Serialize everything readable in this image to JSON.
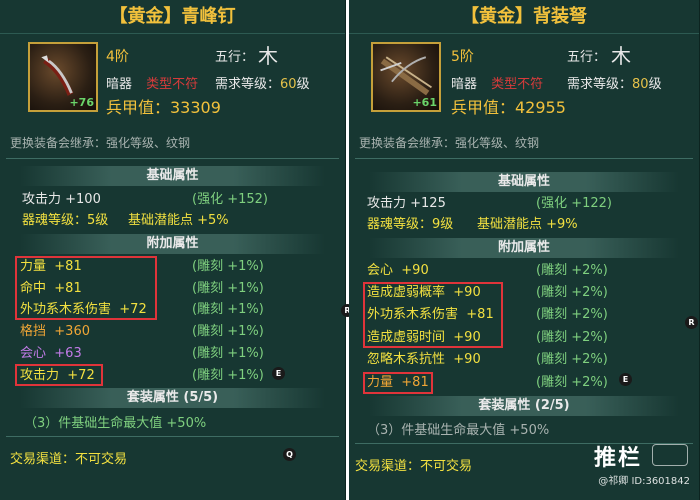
{
  "left": {
    "title": "【黄金】青峰钉",
    "icon_name": "dart-weapon-icon",
    "icon_level": "+76",
    "tier": "4阶",
    "wuxing_label": "五行：",
    "wuxing_glyph": "木",
    "type_label": "暗器",
    "type_status": "类型不符",
    "req_label": "需求等级：",
    "req_value": "60",
    "req_unit": "级",
    "bingjia": "兵甲值：33309",
    "note": "更换装备会继承：强化等级、纹钢",
    "basic_header": "基础属性",
    "basic": [
      {
        "left": "攻击力 +100",
        "right": "(强化 +152)"
      },
      {
        "left": "器魂等级：5级",
        "right": "基础潜能点 +5%"
      }
    ],
    "extra_header": "附加属性",
    "extra": [
      {
        "name": "力量",
        "val": "+81",
        "right": "(雕刻 +1%)",
        "color": "yellow"
      },
      {
        "name": "命中",
        "val": "+81",
        "right": "(雕刻 +1%)",
        "color": "yellow"
      },
      {
        "name": "外功系木系伤害",
        "val": "+72",
        "right": "(雕刻 +1%)",
        "color": "yellow"
      },
      {
        "name": "格挡",
        "val": "+360",
        "right": "(雕刻 +1%)",
        "color": "orange"
      },
      {
        "name": "会心",
        "val": "+63",
        "right": "(雕刻 +1%)",
        "color": "purple"
      },
      {
        "name": "攻击力",
        "val": "+72",
        "right": "(雕刻 +1%)",
        "color": "yellow"
      }
    ],
    "set_header": "套装属性 (5/5)",
    "set_bonus": "（3）件基础生命最大值  +50%",
    "trade": "交易渠道：不可交易",
    "btn_e": "E",
    "btn_r": "R",
    "btn_q": "Q"
  },
  "right": {
    "title": "【黄金】背装弩",
    "icon_name": "crossbow-weapon-icon",
    "icon_level": "+61",
    "tier": "5阶",
    "wuxing_label": "五行：",
    "wuxing_glyph": "木",
    "type_label": "暗器",
    "type_status": "类型不符",
    "req_label": "需求等级：",
    "req_value": "80",
    "req_unit": "级",
    "bingjia": "兵甲值：42955",
    "note": "更换装备会继承：强化等级、纹钢",
    "basic_header": "基础属性",
    "basic": [
      {
        "left": "攻击力 +125",
        "right": "(强化 +122)"
      },
      {
        "left": "器魂等级：9级",
        "right": "基础潜能点 +9%"
      }
    ],
    "extra_header": "附加属性",
    "extra": [
      {
        "name": "会心",
        "val": "+90",
        "right": "(雕刻 +2%)",
        "color": "yellow"
      },
      {
        "name": "造成虚弱概率",
        "val": "+90",
        "right": "(雕刻 +2%)",
        "color": "yellow"
      },
      {
        "name": "外功系木系伤害",
        "val": "+81",
        "right": "(雕刻 +2%)",
        "color": "yellow"
      },
      {
        "name": "造成虚弱时间",
        "val": "+90",
        "right": "(雕刻 +2%)",
        "color": "yellow"
      },
      {
        "name": "忽略木系抗性",
        "val": "+90",
        "right": "(雕刻 +2%)",
        "color": "yellow"
      },
      {
        "name": "力量",
        "val": "+81",
        "right": "(雕刻 +2%)",
        "color": "orange"
      }
    ],
    "set_header": "套装属性 (2/5)",
    "set_bonus": "（3）件基础生命最大值  +50%",
    "trade": "交易渠道：不可交易",
    "btn_e": "E",
    "btn_r": "R"
  },
  "watermark": {
    "big": "推栏",
    "small": "@祁卿  ID:3601842"
  },
  "colors": {
    "panel_bg": "#173732",
    "title_gold": "#f2c13c",
    "stat_green": "#7fd07f",
    "stat_yellow": "#f2e040",
    "stat_orange": "#f0a636",
    "stat_purple": "#c27be8",
    "highlight_red": "#e0343a"
  }
}
